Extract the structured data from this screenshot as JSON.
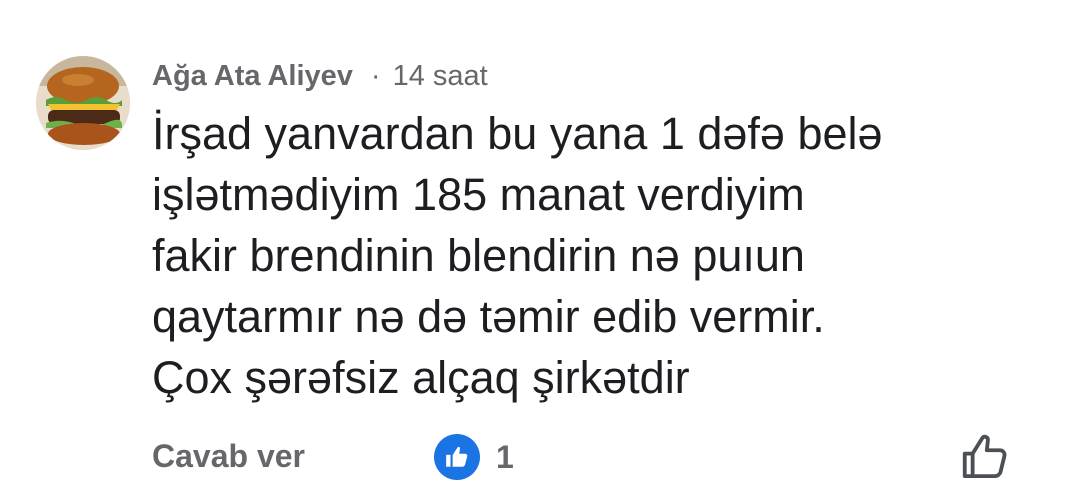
{
  "comment": {
    "author": "Ağa Ata Aliyev",
    "separator": "·",
    "time": "14 saat",
    "text_lines": [
      "İrşad yanvardan bu yana 1 dəfə belə",
      "işlətmədiyim 185 manat verdiyim",
      "fakir brendinin blendirin nə puıun",
      "qaytarmır nə də təmir edib vermir.",
      "Çox şərəfsiz alçaq şirkətdir"
    ]
  },
  "actions": {
    "reply_label": "Cavab ver",
    "reaction_count": "1",
    "reaction_icon": "thumbs-up-filled-icon",
    "like_icon": "thumbs-up-outline-icon"
  },
  "colors": {
    "meta_gray": "#65676b",
    "text": "#1c1e21",
    "reaction_blue": "#1b74e4"
  }
}
